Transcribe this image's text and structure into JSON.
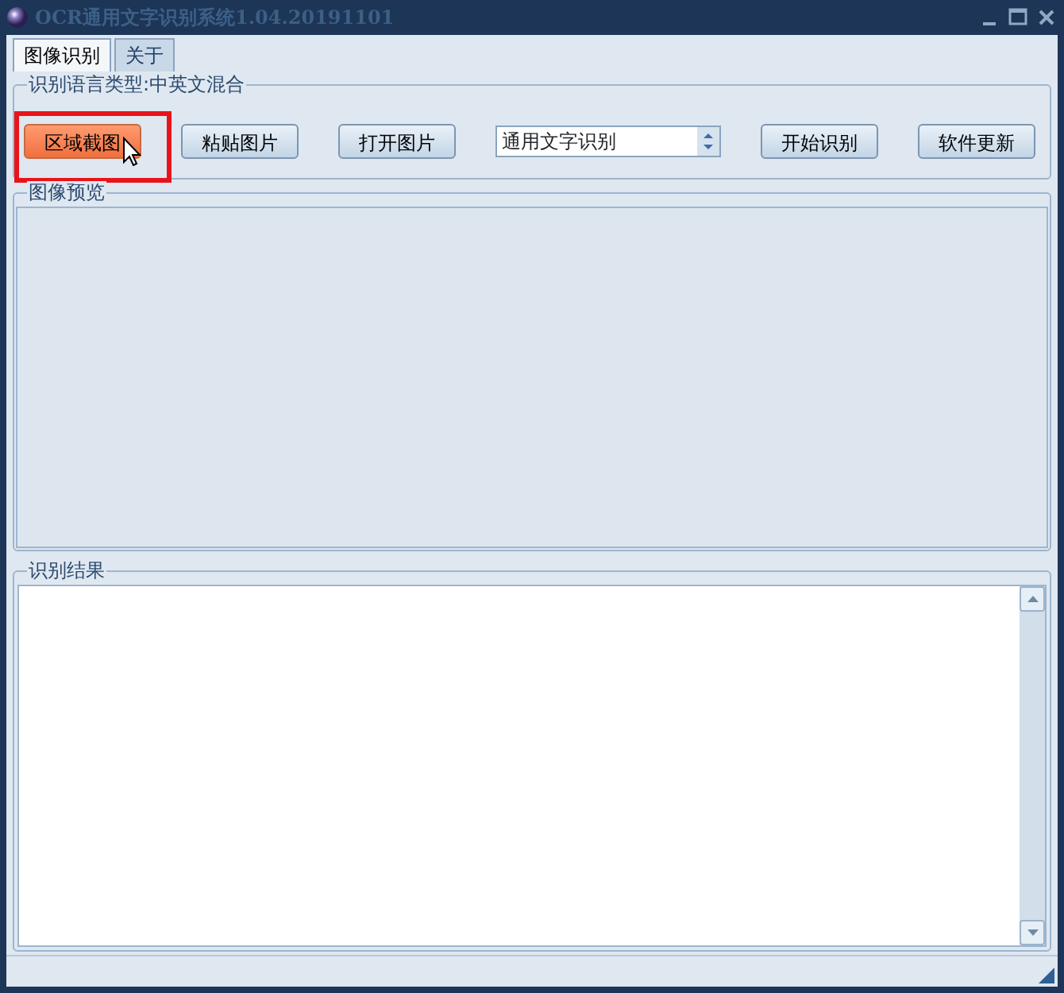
{
  "window": {
    "title": "OCR通用文字识别系统1.04.20191101"
  },
  "tabs": [
    {
      "label": "图像识别",
      "selected": true
    },
    {
      "label": "关于",
      "selected": false
    }
  ],
  "language_group": {
    "legend": "识别语言类型:中英文混合",
    "controls": [
      {
        "kind": "button",
        "label": "区域截图",
        "hovered": true
      },
      {
        "kind": "button",
        "label": "粘贴图片",
        "hovered": false
      },
      {
        "kind": "button",
        "label": "打开图片",
        "hovered": false
      },
      {
        "kind": "select",
        "value": "通用文字识别"
      },
      {
        "kind": "button",
        "label": "开始识别",
        "hovered": false
      },
      {
        "kind": "button",
        "label": "软件更新",
        "hovered": false
      }
    ]
  },
  "preview_group": {
    "legend": "图像预览"
  },
  "result_group": {
    "legend": "识别结果"
  }
}
